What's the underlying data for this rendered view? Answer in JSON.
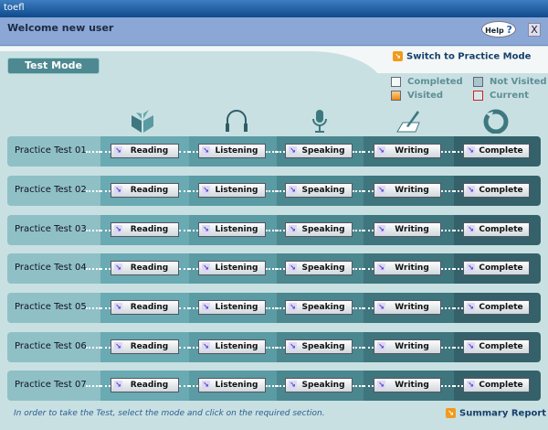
{
  "window": {
    "title": "toefl"
  },
  "header": {
    "welcome": "Welcome new user",
    "help_label": "Help",
    "help_glyph": "?",
    "close_label": "X"
  },
  "mode": {
    "label": "Test Mode",
    "switch_label": "Switch to Practice Mode"
  },
  "legend": {
    "completed": "Completed",
    "not_visited": "Not Visited",
    "visited": "Visited",
    "current": "Current"
  },
  "sections": [
    "Reading",
    "Listening",
    "Speaking",
    "Writing",
    "Complete"
  ],
  "tests": [
    "Practice Test 01",
    "Practice Test 02",
    "Practice Test 03",
    "Practice Test 04",
    "Practice Test 05",
    "Practice Test 06",
    "Practice Test 07"
  ],
  "footer": {
    "hint": "In order to take the Test, select the mode and click on the required section.",
    "summary_label": "Summary Report"
  },
  "colors": {
    "segments": [
      "#8fc0c6",
      "#6aaab2",
      "#5b9ba3",
      "#4b878f",
      "#3f757d",
      "#35626a"
    ],
    "accent": "#f29a1c"
  }
}
